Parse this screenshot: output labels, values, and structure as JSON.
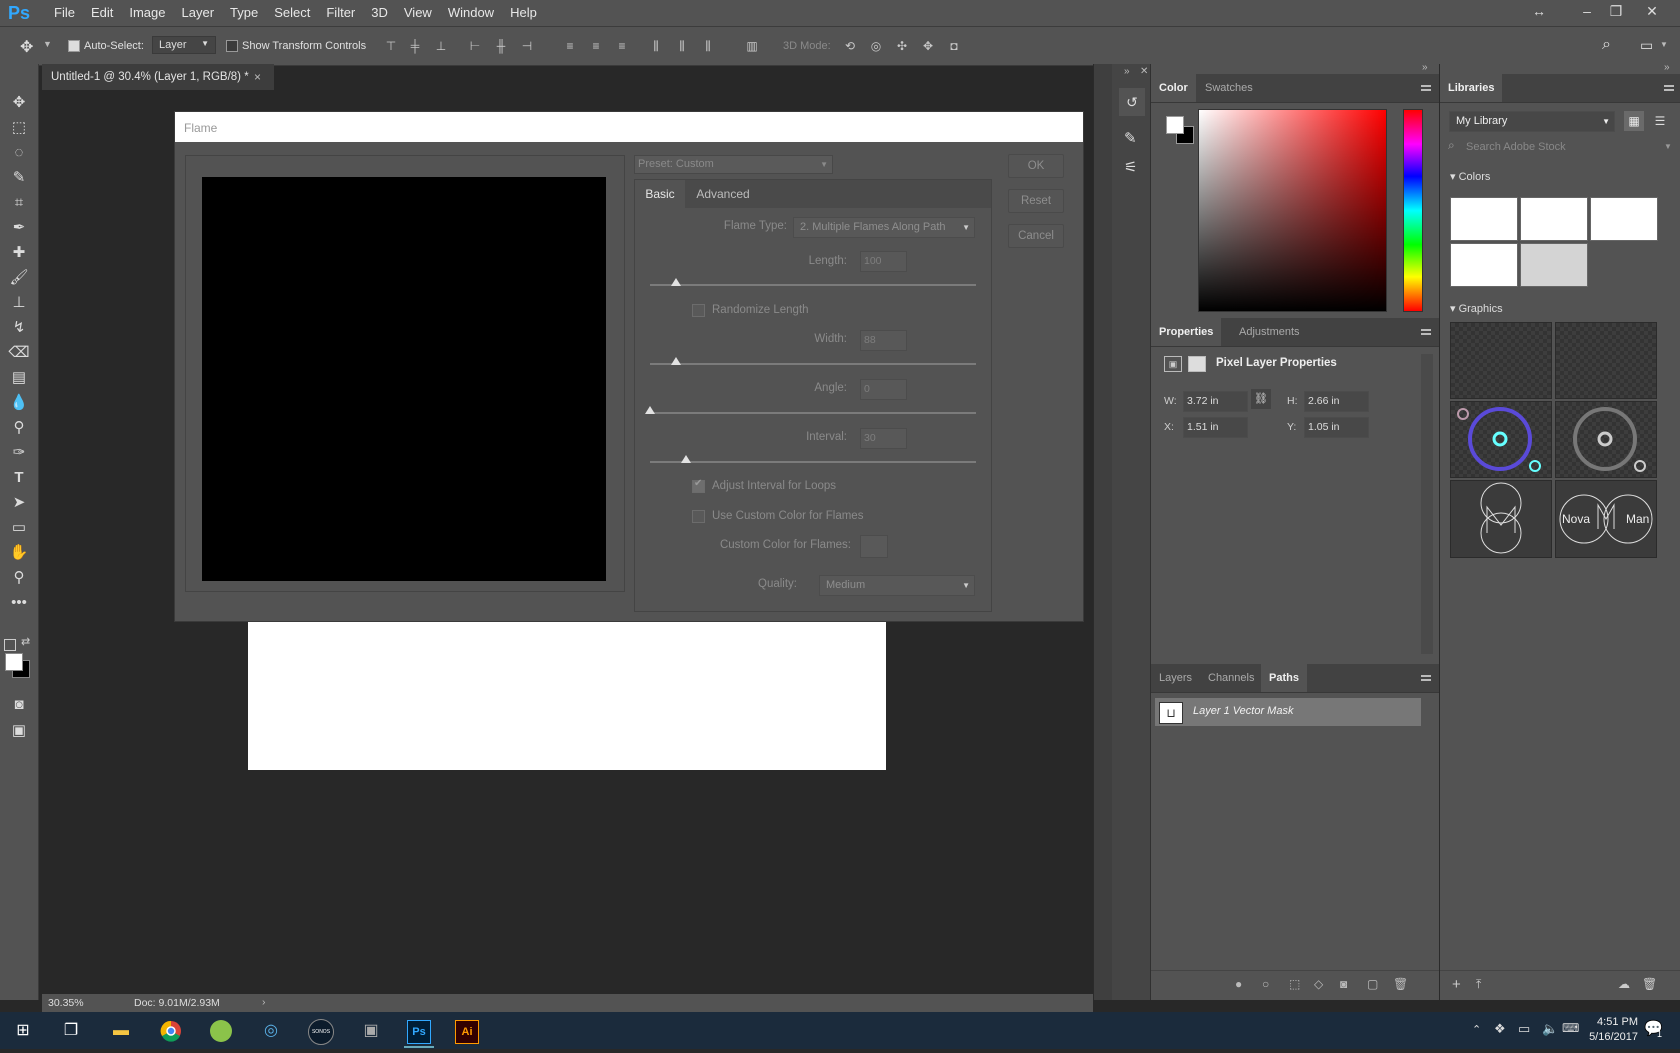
{
  "app": {
    "logo": "Ps",
    "menu": [
      "File",
      "Edit",
      "Image",
      "Layer",
      "Type",
      "Select",
      "Filter",
      "3D",
      "View",
      "Window",
      "Help"
    ],
    "window_controls": [
      "↔",
      "–",
      "❐",
      "✕"
    ]
  },
  "options_bar": {
    "auto_select_label": "Auto-Select:",
    "auto_select_checked": true,
    "auto_select_target": "Layer",
    "show_transform_label": "Show Transform Controls",
    "mode_3d_label": "3D Mode:"
  },
  "document": {
    "tab_title": "Untitled-1 @ 30.4% (Layer 1, RGB/8) *",
    "close": "×",
    "zoom": "30.35%",
    "doc_size": "Doc: 9.01M/2.93M",
    "status_arrow": "›"
  },
  "flame_dialog": {
    "title": "Flame",
    "preset": "Preset: Custom",
    "buttons": {
      "ok": "OK",
      "reset": "Reset",
      "cancel": "Cancel"
    },
    "tabs": [
      "Basic",
      "Advanced"
    ],
    "flame_type_label": "Flame Type:",
    "flame_type_value": "2. Multiple Flames Along Path",
    "length_label": "Length:",
    "length_value": "100",
    "randomize_length_label": "Randomize Length",
    "width_label": "Width:",
    "width_value": "88",
    "angle_label": "Angle:",
    "angle_value": "0",
    "interval_label": "Interval:",
    "interval_value": "30",
    "adjust_interval_label": "Adjust Interval for Loops",
    "use_custom_color_label": "Use Custom Color for Flames",
    "custom_color_label": "Custom Color for Flames:",
    "quality_label": "Quality:",
    "quality_value": "Medium",
    "slider_levels": {
      "length": 0.08,
      "width": 0.08,
      "angle": 0.0,
      "interval": 0.11
    }
  },
  "color_panel": {
    "tabs": [
      "Color",
      "Swatches"
    ],
    "hue_color": "#ff0000"
  },
  "properties_panel": {
    "tabs": [
      "Properties",
      "Adjustments"
    ],
    "heading": "Pixel Layer Properties",
    "w_label": "W:",
    "w_value": "3.72 in",
    "h_label": "H:",
    "h_value": "2.66 in",
    "x_label": "X:",
    "x_value": "1.51 in",
    "y_label": "Y:",
    "y_value": "1.05 in"
  },
  "layers_panel": {
    "tabs": [
      "Layers",
      "Channels",
      "Paths"
    ],
    "path_name": "Layer 1 Vector Mask"
  },
  "libraries_panel": {
    "title": "Libraries",
    "library": "My Library",
    "search_placeholder": "Search Adobe Stock",
    "colors_label": "Colors",
    "graphics_label": "Graphics",
    "color_swatches": [
      "#ffffff",
      "#ffffff",
      "#ffffff",
      "#ffffff",
      "#d4d4d4"
    ],
    "graphic_texts": {
      "nova": "Nova",
      "man": "Man"
    }
  },
  "taskbar": {
    "time": "4:51 PM",
    "date": "5/16/2017",
    "apps": [
      "file-explorer",
      "chrome",
      "app-green",
      "app-blue",
      "sonos",
      "app-gray",
      "photoshop",
      "illustrator"
    ],
    "ps_label": "Ps",
    "ai_label": "Ai",
    "sonos_label": "SONOS",
    "notif": "1"
  }
}
